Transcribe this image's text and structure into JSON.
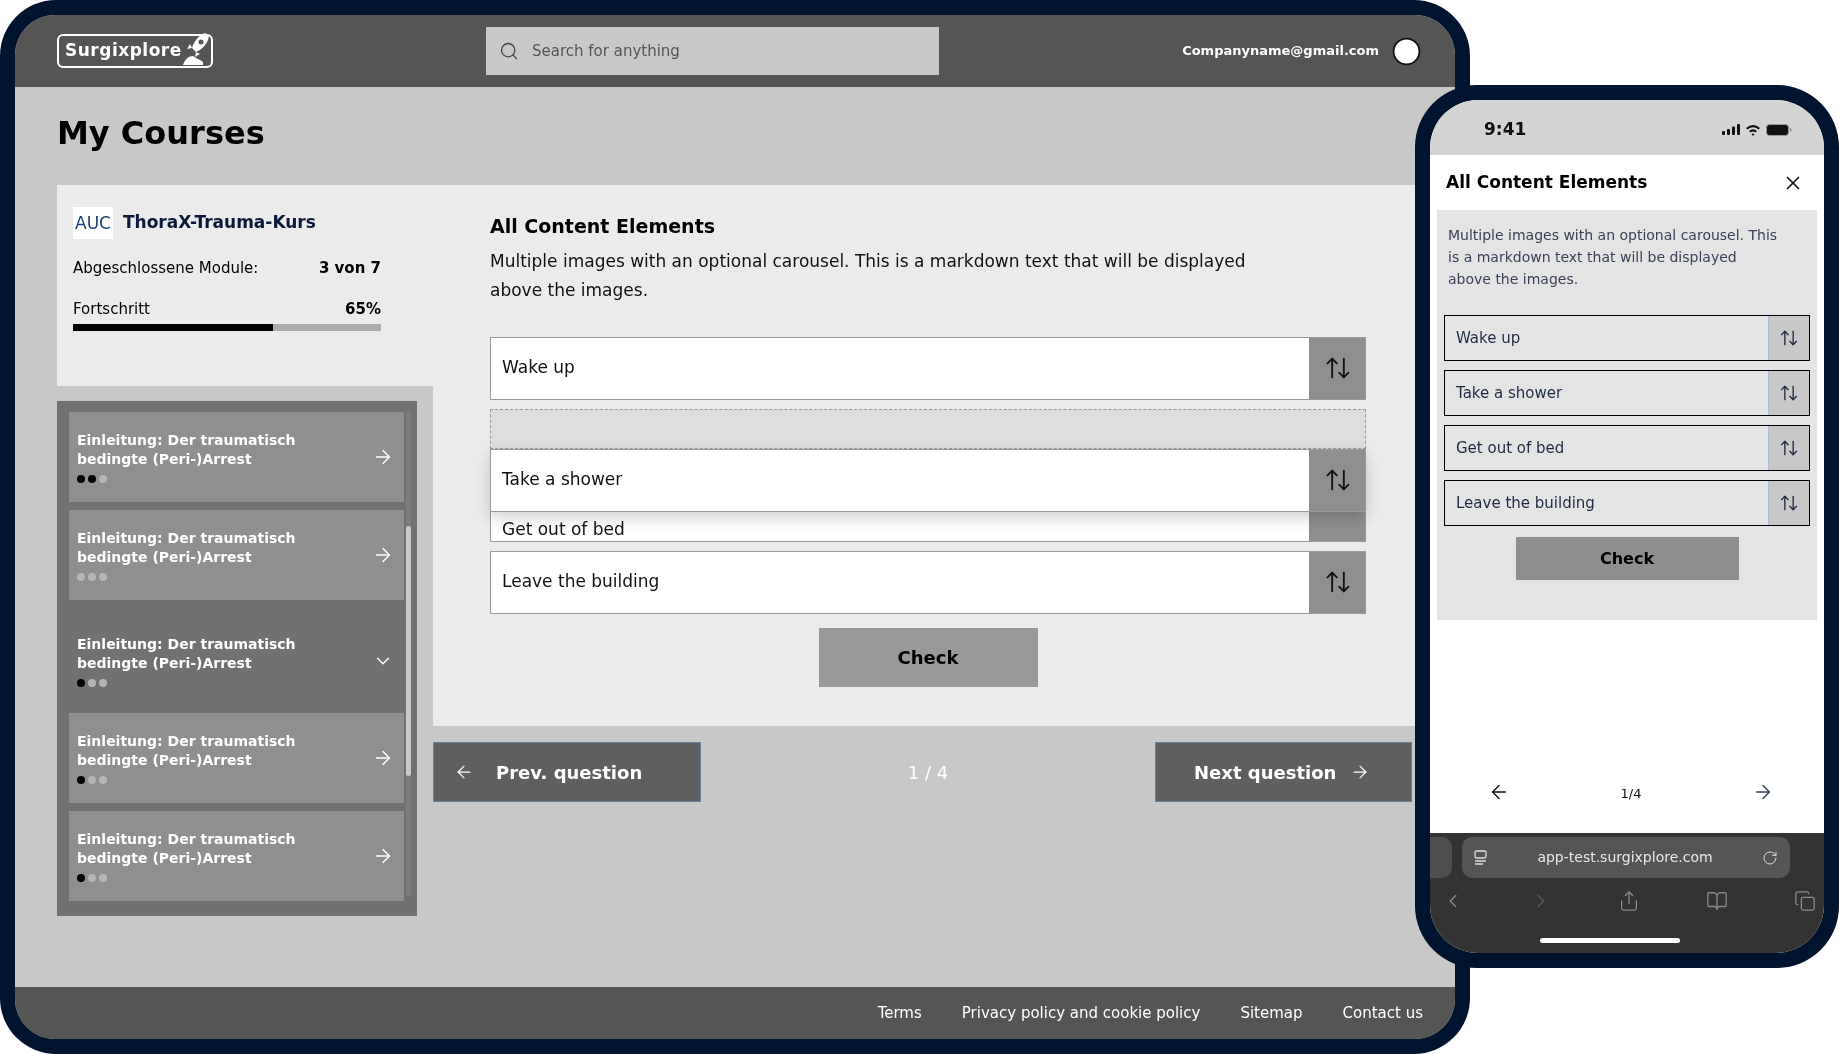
{
  "tablet": {
    "header": {
      "logo": "Surgixplore",
      "search": {
        "placeholder": "Search for anything"
      },
      "email": "Companyname@gmail.com"
    },
    "page_title": "My Courses",
    "course": {
      "logo": "AUC",
      "title": "ThoraX-Trauma-Kurs",
      "modules_label": "Abgeschlossene Module:",
      "modules_value": "3 von 7",
      "progress_label": "Fortschritt",
      "progress_value": "65%",
      "level": 0.65
    },
    "modules": [
      {
        "title": "Einleitung: Der traumatisch bedingte (Peri-)Arrest",
        "expanded": false,
        "steps": [
          {
            "done": true
          },
          {
            "done": true
          },
          {
            "done": false
          }
        ]
      },
      {
        "title": "Einleitung: Der traumatisch bedingte (Peri-)Arrest",
        "expanded": false,
        "steps": [
          {
            "done": false
          },
          {
            "done": false
          },
          {
            "done": false
          }
        ]
      },
      {
        "title": "Einleitung: Der traumatisch bedingte (Peri-)Arrest",
        "expanded": true,
        "steps": [
          {
            "done": true
          },
          {
            "done": false
          },
          {
            "done": false
          }
        ]
      },
      {
        "title": "Einleitung: Der traumatisch bedingte (Peri-)Arrest",
        "expanded": false,
        "steps": [
          {
            "done": true
          },
          {
            "done": false
          },
          {
            "done": false
          }
        ]
      },
      {
        "title": "Einleitung: Der traumatisch bedingte (Peri-)Arrest",
        "expanded": false,
        "steps": [
          {
            "done": true
          },
          {
            "done": false
          },
          {
            "done": false
          }
        ]
      }
    ],
    "content": {
      "title": "All Content Elements",
      "description": "Multiple images with an optional carousel. This is a markdown text that will be displayed above the images.",
      "items": [
        {
          "label": "Wake up",
          "dragging": false
        },
        {
          "label": "Take a shower",
          "dragging": true
        },
        {
          "label": "Get out of bed",
          "dragging": false
        },
        {
          "label": "Leave the building",
          "dragging": false
        }
      ],
      "check": "Check"
    },
    "pager": {
      "prev": "Prev. question",
      "position": "1 / 4",
      "next": "Next question"
    },
    "footer": [
      "Terms",
      "Privacy policy and cookie policy",
      "Sitemap",
      "Contact us"
    ]
  },
  "phone": {
    "time": "9:41",
    "title": "All Content Elements",
    "description": "Multiple images with an optional carousel. This is a markdown text that will be displayed above the images.",
    "items": [
      {
        "label": "Wake up"
      },
      {
        "label": "Take a shower"
      },
      {
        "label": "Get out of bed"
      },
      {
        "label": "Leave the building"
      }
    ],
    "check": "Check",
    "position": "1/4",
    "url": "app-test.surgixplore.com"
  }
}
